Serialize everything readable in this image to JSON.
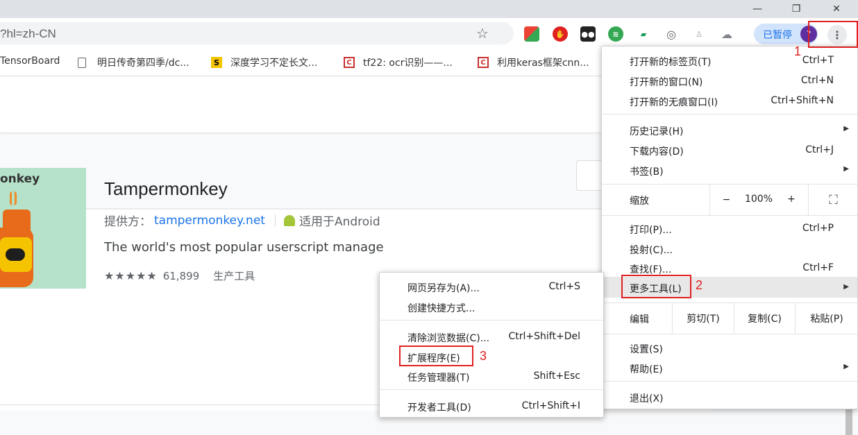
{
  "window": {
    "minimize": "—",
    "restore": "❐",
    "close": "✕"
  },
  "toolbar": {
    "url": "?hl=zh-CN",
    "paused_label": "已暂停",
    "avatar_letter": "?"
  },
  "bookmarks": [
    {
      "label": "TensorBoard",
      "icon": "none"
    },
    {
      "label": "明日传奇第四季/dc...",
      "icon": "page-icon"
    },
    {
      "label": "深度学习不定长文...",
      "icon": "s-logo-icon"
    },
    {
      "label": "tf22: ocr识别——...",
      "icon": "csdn-icon"
    },
    {
      "label": "利用keras框架cnn...",
      "icon": "csdn-icon"
    }
  ],
  "item": {
    "icon_text": "onkey",
    "title": "Tampermonkey",
    "provider_prefix": "提供方：",
    "provider_link": "tampermonkey.net",
    "platform": "适用于Android",
    "description": "The world's most popular userscript manage",
    "stars": "★★★★★",
    "rating_count": "61,899",
    "category": "生产工具"
  },
  "main_menu": {
    "new_tab": {
      "label": "打开新的标签页(T)",
      "shortcut": "Ctrl+T"
    },
    "new_window": {
      "label": "打开新的窗口(N)",
      "shortcut": "Ctrl+N"
    },
    "incognito": {
      "label": "打开新的无痕窗口(I)",
      "shortcut": "Ctrl+Shift+N"
    },
    "history": {
      "label": "历史记录(H)"
    },
    "downloads": {
      "label": "下载内容(D)",
      "shortcut": "Ctrl+J"
    },
    "bookmarks": {
      "label": "书签(B)"
    },
    "zoom": {
      "label": "缩放",
      "minus": "−",
      "value": "100%",
      "plus": "+",
      "fullscreen": "⛶"
    },
    "print": {
      "label": "打印(P)...",
      "shortcut": "Ctrl+P"
    },
    "cast": {
      "label": "投射(C)..."
    },
    "find": {
      "label": "查找(F)...",
      "shortcut": "Ctrl+F"
    },
    "more_tools": {
      "label": "更多工具(L)"
    },
    "edit": {
      "label": "编辑",
      "cut": "剪切(T)",
      "copy": "复制(C)",
      "paste": "粘贴(P)"
    },
    "settings": {
      "label": "设置(S)"
    },
    "help": {
      "label": "帮助(E)"
    },
    "exit": {
      "label": "退出(X)"
    }
  },
  "sub_menu": {
    "save_as": {
      "label": "网页另存为(A)...",
      "shortcut": "Ctrl+S"
    },
    "create_shortcut": {
      "label": "创建快捷方式..."
    },
    "clear_data": {
      "label": "清除浏览数据(C)...",
      "shortcut": "Ctrl+Shift+Del"
    },
    "extensions": {
      "label": "扩展程序(E)"
    },
    "task_manager": {
      "label": "任务管理器(T)",
      "shortcut": "Shift+Esc"
    },
    "dev_tools": {
      "label": "开发者工具(D)",
      "shortcut": "Ctrl+Shift+I"
    }
  },
  "annotations": {
    "step1": "1",
    "step2": "2",
    "step3": "3",
    "color": "#e02020"
  }
}
